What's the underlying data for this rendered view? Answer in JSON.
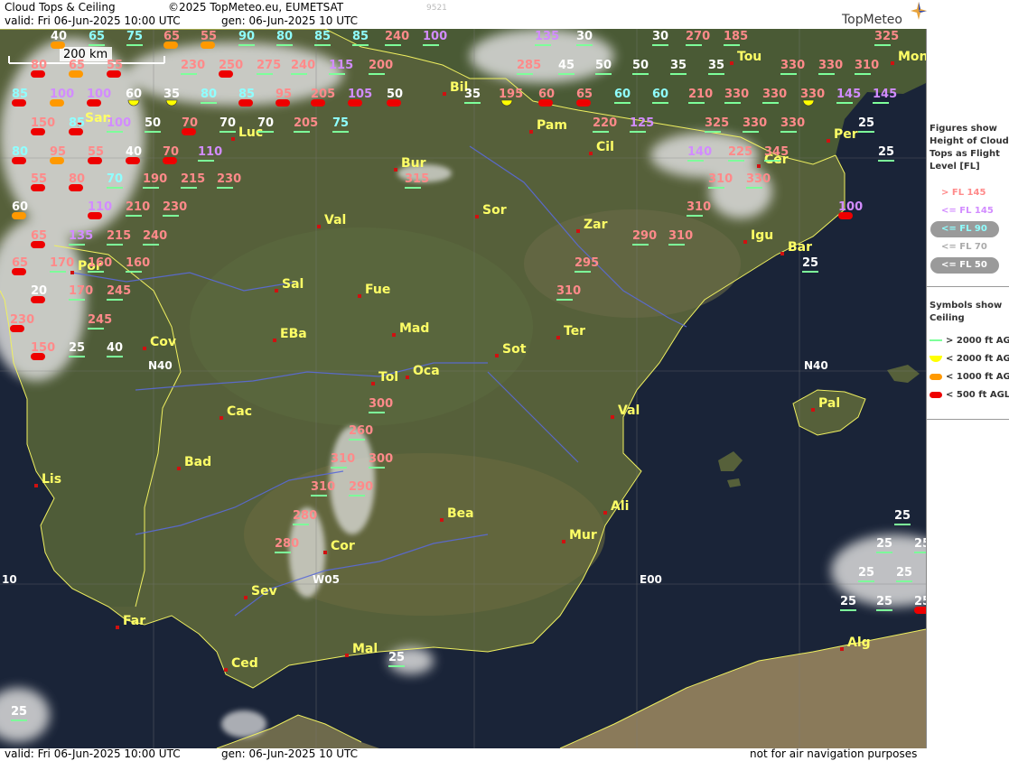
{
  "header": {
    "title": "Cloud Tops & Ceiling",
    "copyright": "©2025 TopMeteo.eu, EUMETSAT",
    "valid": "valid:  Fri  06-Jun-2025  10:00 UTC",
    "gen": "gen: 06-Jun-2025 10 UTC",
    "image_id": "9521",
    "logo": "TopMeteo"
  },
  "footer": {
    "valid": "valid:  Fri  06-Jun-2025  10:00 UTC",
    "gen": "gen: 06-Jun-2025 10 UTC",
    "disclaimer": "not for air navigation purposes"
  },
  "scale_bar": "200 km",
  "grid_labels": [
    "N40",
    "N40",
    "W05",
    "E00",
    "10"
  ],
  "cities": [
    "Tou",
    "Mon",
    "Bil",
    "Pam",
    "Luc",
    "San",
    "Per",
    "Cil",
    "Cer",
    "Bur",
    "Sor",
    "Val",
    "Zar",
    "Igu",
    "Bar",
    "Sal",
    "Fue",
    "Por",
    "Mad",
    "EBa",
    "Ter",
    "Cov",
    "Tol",
    "Oca",
    "Sot",
    "Cac",
    "Val",
    "Pal",
    "Bad",
    "Lis",
    "Bea",
    "Ali",
    "Cor",
    "Mur",
    "Sev",
    "Far",
    "Ced",
    "Mal",
    "Alg"
  ],
  "legend": {
    "figures_header": "Figures show Height of Cloud Tops as Flight Level  [FL]",
    "figures": [
      {
        "label": "> FL 145",
        "color": "#ff8a8a"
      },
      {
        "label": "<= FL 145",
        "color": "#d28cff"
      },
      {
        "label": "<= FL 90",
        "color": "#8fffff"
      },
      {
        "label": "<= FL 70",
        "color": "#ffffff"
      },
      {
        "label": "<= FL 50",
        "color": "#ffffff"
      }
    ],
    "symbols_header": "Symbols show Ceiling",
    "symbols": [
      {
        "label": "> 2000 ft AGL",
        "symbol": "line",
        "color": "#7dff9a"
      },
      {
        "label": "< 2000 ft AGL",
        "symbol": "half-circle",
        "color": "#ffff00"
      },
      {
        "label": "< 1000 ft AGL",
        "symbol": "pill",
        "color": "#ff9900"
      },
      {
        "label": "< 500 ft AGL",
        "symbol": "pill",
        "color": "#ee0000"
      }
    ]
  },
  "map_labels": [
    {
      "v": "40",
      "c": "w",
      "s": "o"
    },
    {
      "v": "65",
      "c": "c",
      "s": "g"
    },
    {
      "v": "75",
      "c": "c",
      "s": "g"
    },
    {
      "v": "65",
      "c": "r",
      "s": "o"
    },
    {
      "v": "55",
      "c": "r",
      "s": "o"
    },
    {
      "v": "90",
      "c": "c",
      "s": "g"
    },
    {
      "v": "80",
      "c": "c",
      "s": "g"
    },
    {
      "v": "85",
      "c": "c",
      "s": "g"
    },
    {
      "v": "85",
      "c": "c",
      "s": "g"
    },
    {
      "v": "240",
      "c": "r",
      "s": "g"
    },
    {
      "v": "100",
      "c": "p",
      "s": "g"
    },
    {
      "v": "135",
      "c": "p",
      "s": "g"
    },
    {
      "v": "30",
      "c": "w",
      "s": "g"
    },
    {
      "v": "30",
      "c": "w",
      "s": "g"
    },
    {
      "v": "270",
      "c": "r",
      "s": "g"
    },
    {
      "v": "185",
      "c": "r",
      "s": "g"
    },
    {
      "v": "325",
      "c": "r",
      "s": "g"
    },
    {
      "v": "80",
      "c": "r",
      "s": "r"
    },
    {
      "v": "65",
      "c": "r",
      "s": "o"
    },
    {
      "v": "55",
      "c": "r",
      "s": "r"
    },
    {
      "v": "230",
      "c": "r",
      "s": "g"
    },
    {
      "v": "250",
      "c": "r",
      "s": "r"
    },
    {
      "v": "275",
      "c": "r",
      "s": "g"
    },
    {
      "v": "240",
      "c": "r",
      "s": "g"
    },
    {
      "v": "115",
      "c": "p",
      "s": "g"
    },
    {
      "v": "200",
      "c": "r",
      "s": "g"
    },
    {
      "v": "285",
      "c": "r",
      "s": "g"
    },
    {
      "v": "45",
      "c": "w",
      "s": "g"
    },
    {
      "v": "50",
      "c": "w",
      "s": "g"
    },
    {
      "v": "50",
      "c": "w",
      "s": "g"
    },
    {
      "v": "35",
      "c": "w",
      "s": "g"
    },
    {
      "v": "35",
      "c": "w",
      "s": "g"
    },
    {
      "v": "330",
      "c": "r",
      "s": "g"
    },
    {
      "v": "330",
      "c": "r",
      "s": "g"
    },
    {
      "v": "310",
      "c": "r",
      "s": "g"
    },
    {
      "v": "85",
      "c": "c",
      "s": "r"
    },
    {
      "v": "100",
      "c": "p",
      "s": "o"
    },
    {
      "v": "100",
      "c": "p",
      "s": "r"
    },
    {
      "v": "60",
      "c": "w",
      "s": "y"
    },
    {
      "v": "35",
      "c": "w",
      "s": "y"
    },
    {
      "v": "80",
      "c": "c",
      "s": "g"
    },
    {
      "v": "85",
      "c": "c",
      "s": "r"
    },
    {
      "v": "95",
      "c": "r",
      "s": "r"
    },
    {
      "v": "205",
      "c": "r",
      "s": "r"
    },
    {
      "v": "105",
      "c": "p",
      "s": "r"
    },
    {
      "v": "50",
      "c": "w",
      "s": "r"
    },
    {
      "v": "35",
      "c": "w",
      "s": "g"
    },
    {
      "v": "195",
      "c": "r",
      "s": "y"
    },
    {
      "v": "60",
      "c": "r",
      "s": "r"
    },
    {
      "v": "65",
      "c": "r",
      "s": "r"
    },
    {
      "v": "60",
      "c": "c",
      "s": "g"
    },
    {
      "v": "60",
      "c": "c",
      "s": "g"
    },
    {
      "v": "210",
      "c": "r",
      "s": "g"
    },
    {
      "v": "330",
      "c": "r",
      "s": "g"
    },
    {
      "v": "330",
      "c": "r",
      "s": "g"
    },
    {
      "v": "330",
      "c": "r",
      "s": "y"
    },
    {
      "v": "145",
      "c": "p",
      "s": "g"
    },
    {
      "v": "145",
      "c": "p",
      "s": "g"
    },
    {
      "v": "150",
      "c": "r",
      "s": "r"
    },
    {
      "v": "85",
      "c": "c",
      "s": "r"
    },
    {
      "v": "100",
      "c": "p",
      "s": "g"
    },
    {
      "v": "50",
      "c": "w",
      "s": "g"
    },
    {
      "v": "70",
      "c": "r",
      "s": "r"
    },
    {
      "v": "70",
      "c": "w",
      "s": "g"
    },
    {
      "v": "70",
      "c": "w",
      "s": "g"
    },
    {
      "v": "205",
      "c": "r",
      "s": "g"
    },
    {
      "v": "75",
      "c": "c",
      "s": "g"
    },
    {
      "v": "220",
      "c": "r",
      "s": "g"
    },
    {
      "v": "125",
      "c": "p",
      "s": "g"
    },
    {
      "v": "325",
      "c": "r",
      "s": "g"
    },
    {
      "v": "330",
      "c": "r",
      "s": "g"
    },
    {
      "v": "330",
      "c": "r",
      "s": "g"
    },
    {
      "v": "25",
      "c": "w",
      "s": "g"
    },
    {
      "v": "80",
      "c": "c",
      "s": "r"
    },
    {
      "v": "95",
      "c": "r",
      "s": "o"
    },
    {
      "v": "55",
      "c": "r",
      "s": "r"
    },
    {
      "v": "40",
      "c": "w",
      "s": "r"
    },
    {
      "v": "70",
      "c": "r",
      "s": "r"
    },
    {
      "v": "110",
      "c": "p",
      "s": "g"
    },
    {
      "v": "140",
      "c": "p",
      "s": "g"
    },
    {
      "v": "225",
      "c": "r",
      "s": "g"
    },
    {
      "v": "345",
      "c": "r",
      "s": "g"
    },
    {
      "v": "25",
      "c": "w",
      "s": "g"
    },
    {
      "v": "55",
      "c": "r",
      "s": "r"
    },
    {
      "v": "80",
      "c": "r",
      "s": "r"
    },
    {
      "v": "70",
      "c": "c",
      "s": "g"
    },
    {
      "v": "190",
      "c": "r",
      "s": "g"
    },
    {
      "v": "215",
      "c": "r",
      "s": "g"
    },
    {
      "v": "230",
      "c": "r",
      "s": "g"
    },
    {
      "v": "315",
      "c": "r",
      "s": "g"
    },
    {
      "v": "310",
      "c": "r",
      "s": "g"
    },
    {
      "v": "330",
      "c": "r",
      "s": "g"
    },
    {
      "v": "60",
      "c": "w",
      "s": "o"
    },
    {
      "v": "110",
      "c": "p",
      "s": "r"
    },
    {
      "v": "210",
      "c": "r",
      "s": "g"
    },
    {
      "v": "230",
      "c": "r",
      "s": "g"
    },
    {
      "v": "310",
      "c": "r",
      "s": "g"
    },
    {
      "v": "100",
      "c": "p",
      "s": "r"
    },
    {
      "v": "65",
      "c": "r",
      "s": "r"
    },
    {
      "v": "135",
      "c": "p",
      "s": "g"
    },
    {
      "v": "215",
      "c": "r",
      "s": "g"
    },
    {
      "v": "240",
      "c": "r",
      "s": "g"
    },
    {
      "v": "290",
      "c": "r",
      "s": "g"
    },
    {
      "v": "310",
      "c": "r",
      "s": "g"
    },
    {
      "v": "65",
      "c": "r",
      "s": "r"
    },
    {
      "v": "170",
      "c": "r",
      "s": "g"
    },
    {
      "v": "160",
      "c": "r",
      "s": "g"
    },
    {
      "v": "160",
      "c": "r",
      "s": "g"
    },
    {
      "v": "295",
      "c": "r",
      "s": "g"
    },
    {
      "v": "25",
      "c": "w",
      "s": "g"
    },
    {
      "v": "20",
      "c": "w",
      "s": "r"
    },
    {
      "v": "170",
      "c": "r",
      "s": "g"
    },
    {
      "v": "245",
      "c": "r",
      "s": "g"
    },
    {
      "v": "310",
      "c": "r",
      "s": "g"
    },
    {
      "v": "230",
      "c": "r",
      "s": "r"
    },
    {
      "v": "245",
      "c": "r",
      "s": "g"
    },
    {
      "v": "150",
      "c": "r",
      "s": "r"
    },
    {
      "v": "25",
      "c": "w",
      "s": "g"
    },
    {
      "v": "40",
      "c": "w",
      "s": "g"
    },
    {
      "v": "300",
      "c": "r",
      "s": "g"
    },
    {
      "v": "260",
      "c": "r",
      "s": "g"
    },
    {
      "v": "310",
      "c": "r",
      "s": "g"
    },
    {
      "v": "300",
      "c": "r",
      "s": "g"
    },
    {
      "v": "310",
      "c": "r",
      "s": "g"
    },
    {
      "v": "290",
      "c": "r",
      "s": "g"
    },
    {
      "v": "280",
      "c": "r",
      "s": "g"
    },
    {
      "v": "280",
      "c": "r",
      "s": "g"
    },
    {
      "v": "25",
      "c": "w",
      "s": "g"
    },
    {
      "v": "25",
      "c": "w",
      "s": "g"
    },
    {
      "v": "25",
      "c": "w",
      "s": "g"
    },
    {
      "v": "25",
      "c": "w",
      "s": "g"
    },
    {
      "v": "25",
      "c": "w",
      "s": "g"
    },
    {
      "v": "25",
      "c": "w",
      "s": "g"
    },
    {
      "v": "25",
      "c": "w",
      "s": "g"
    },
    {
      "v": "25",
      "c": "w",
      "s": "r"
    },
    {
      "v": "25",
      "c": "w",
      "s": "g"
    },
    {
      "v": "25",
      "c": "w",
      "s": "g"
    },
    {
      "v": "25",
      "c": "w",
      "s": "g"
    }
  ]
}
